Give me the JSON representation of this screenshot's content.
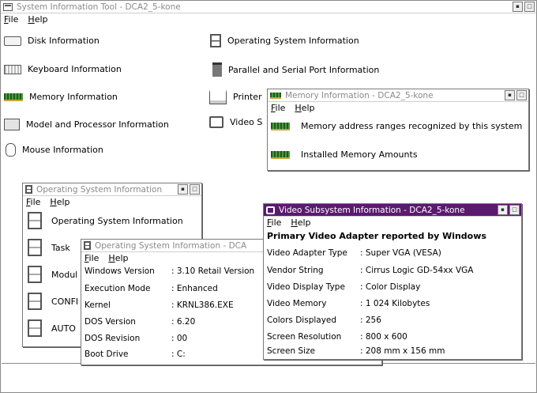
{
  "menu": {
    "file": "File",
    "help": "Help"
  },
  "main": {
    "title": "System Information Tool - DCA2_5-kone",
    "items": [
      "Disk Information",
      "Keyboard Information",
      "Memory Information",
      "Model and Processor Information",
      "Mouse Information",
      "Operating System Information",
      "Parallel and Serial Port Information",
      "Printer",
      "Video S"
    ]
  },
  "memory": {
    "title": "Memory Information - DCA2_5-kone",
    "items": [
      "Memory address ranges recognized by this system",
      "Installed Memory Amounts"
    ]
  },
  "os_small": {
    "title": "Operating System Information",
    "items": [
      "Operating System Information",
      "Task",
      "Modul",
      "CONFI",
      "AUTO"
    ]
  },
  "os_detail": {
    "title": "Operating System Information - DCA",
    "rows": [
      {
        "k": "Windows Version",
        "v": ": 3.10 Retail Version"
      },
      {
        "k": "Execution Mode",
        "v": ": Enhanced"
      },
      {
        "k": "Kernel",
        "v": ": KRNL386.EXE"
      },
      {
        "k": "DOS Version",
        "v": ": 6.20"
      },
      {
        "k": "DOS Revision",
        "v": ": 00"
      },
      {
        "k": "Boot Drive",
        "v": ": C:"
      }
    ]
  },
  "video": {
    "title": "Video Subsystem Information - DCA2_5-kone",
    "heading": "Primary Video Adapter reported by Windows",
    "rows": [
      {
        "k": "Video Adapter Type",
        "v": ": Super VGA (VESA)"
      },
      {
        "k": "Vendor String",
        "v": ": Cirrus Logic GD-54xx VGA"
      },
      {
        "k": "Video Display Type",
        "v": ": Color Display"
      },
      {
        "k": "Video Memory",
        "v": ": 1 024 Kilobytes"
      },
      {
        "k": "Colors Displayed",
        "v": ": 256"
      },
      {
        "k": "Screen Resolution",
        "v": ": 800 x 600"
      },
      {
        "k": "Screen Size",
        "v": ": 208 mm x 156 mm"
      }
    ]
  },
  "icons": {
    "disk": "disk-icon",
    "keyboard": "keyboard-icon",
    "memory": "memory-chip-icon",
    "model": "computer-icon",
    "mouse": "mouse-icon",
    "os": "os-icon",
    "parallel": "port-icon",
    "printer": "printer-icon",
    "video": "monitor-icon"
  },
  "colors": {
    "active_title": "#5a1a6e",
    "memory_chip": "#2f7a2f"
  }
}
